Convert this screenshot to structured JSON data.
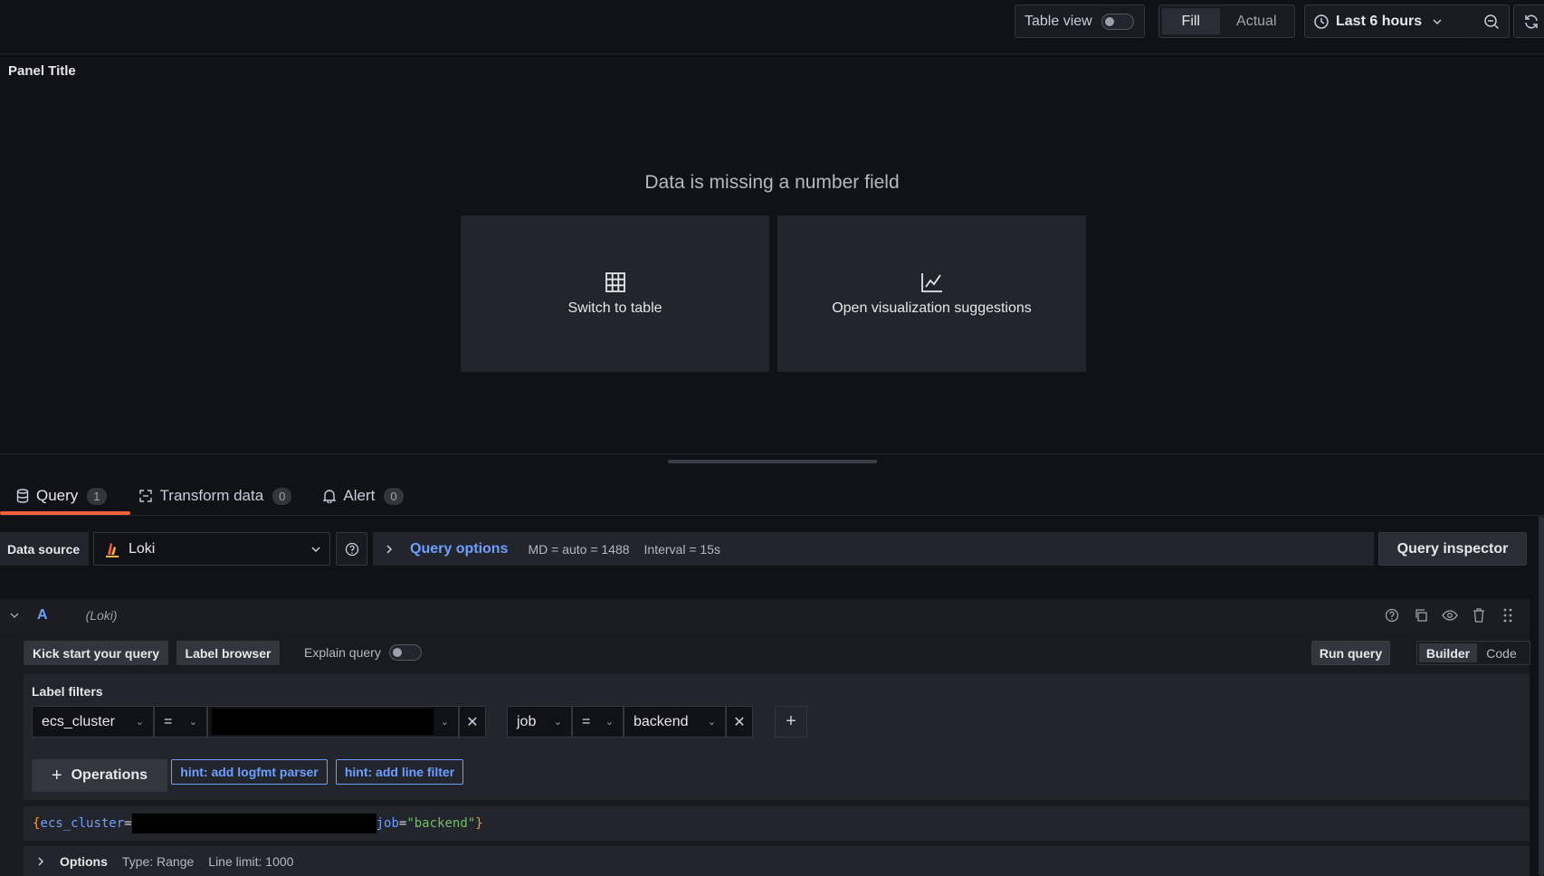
{
  "toolbar": {
    "table_view_label": "Table view",
    "fill_label": "Fill",
    "actual_label": "Actual",
    "time_range": "Last 6 hours"
  },
  "panel": {
    "title": "Panel Title",
    "message": "Data is missing a number field",
    "switch_to_table": "Switch to table",
    "open_suggestions": "Open visualization suggestions"
  },
  "tabs": [
    {
      "label": "Query",
      "count": "1"
    },
    {
      "label": "Transform data",
      "count": "0"
    },
    {
      "label": "Alert",
      "count": "0"
    }
  ],
  "datasource": {
    "label": "Data source",
    "name": "Loki",
    "query_options_label": "Query options",
    "md": "MD = auto = 1488",
    "interval": "Interval = 15s",
    "query_inspector": "Query inspector"
  },
  "query": {
    "ref": "A",
    "ds": "(Loki)",
    "kick_start": "Kick start your query",
    "label_browser": "Label browser",
    "explain_query": "Explain query",
    "run_query": "Run query",
    "mode_builder": "Builder",
    "mode_code": "Code",
    "label_filters_title": "Label filters",
    "filters": [
      {
        "label": "ecs_cluster",
        "op": "=",
        "value": ""
      },
      {
        "label": "job",
        "op": "=",
        "value": "backend"
      }
    ],
    "operations_label": "Operations",
    "hint_logfmt": "hint: add logfmt parser",
    "hint_line_filter": "hint: add line filter",
    "raw": {
      "open": "{",
      "label1": "ecs_cluster",
      "eq": "=",
      "label2": "job",
      "value2": "\"backend\"",
      "close": "}"
    },
    "options_label": "Options",
    "type_text": "Type: Range",
    "line_limit_text": "Line limit: 1000"
  },
  "colors": {
    "accent": "#6e9fff",
    "tab_active": "#f55f3e",
    "background": "#111217"
  }
}
